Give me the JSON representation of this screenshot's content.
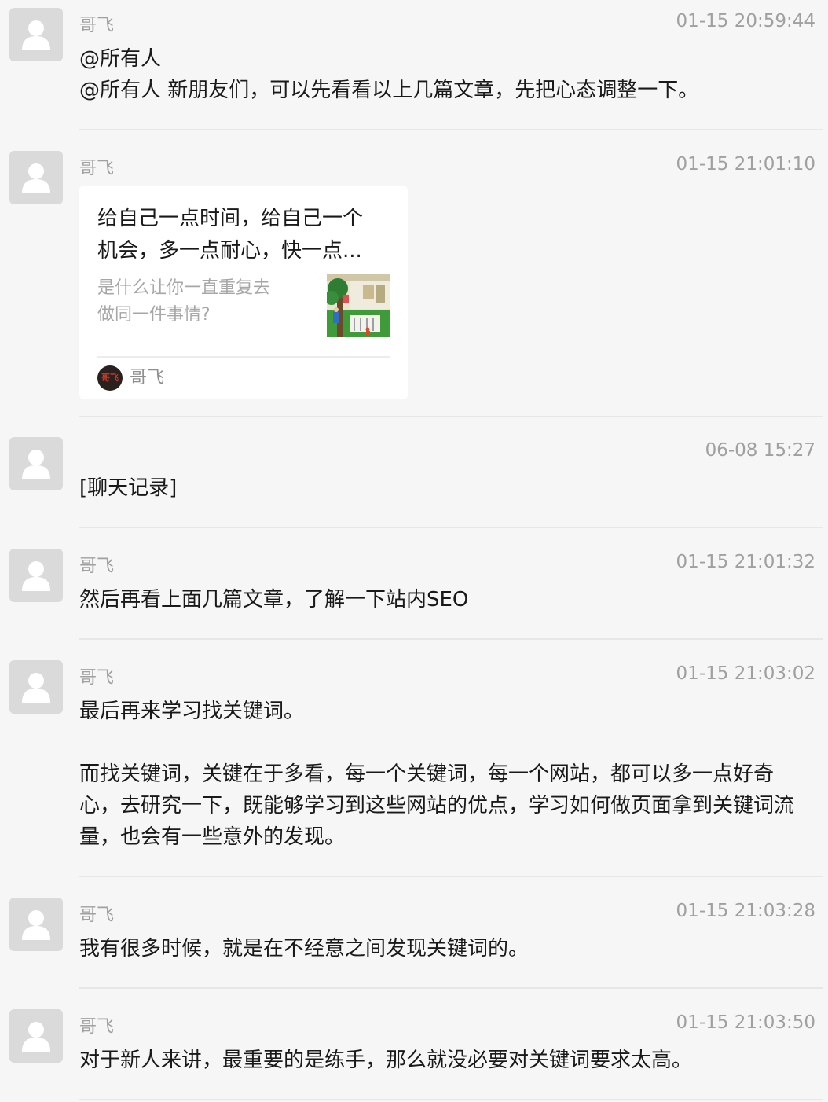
{
  "messages": [
    {
      "sender": "哥飞",
      "time": "01-15 20:59:44",
      "text": "@所有人\n@所有人 新朋友们，可以先看看以上几篇文章，先把心态调整一下。"
    },
    {
      "sender": "哥飞",
      "time": "01-15 21:01:10",
      "card": {
        "title": "给自己一点时间，给自己一个\n机会，多一点耐心，快一点...",
        "description": "是什么让你一直重复去\n做同一件事情?",
        "source_name": "哥飞",
        "source_avatar_text": "哥飞"
      }
    },
    {
      "sender": "",
      "time": "06-08 15:27",
      "text": "[聊天记录]"
    },
    {
      "sender": "哥飞",
      "time": "01-15 21:01:32",
      "text": "然后再看上面几篇文章，了解一下站内SEO"
    },
    {
      "sender": "哥飞",
      "time": "01-15 21:03:02",
      "text": "最后再来学习找关键词。\n\n而找关键词，关键在于多看，每一个关键词，每一个网站，都可以多一点好奇心，去研究一下，既能够学习到这些网站的优点，学习如何做页面拿到关键词流量，也会有一些意外的发现。"
    },
    {
      "sender": "哥飞",
      "time": "01-15 21:03:28",
      "text": "我有很多时候，就是在不经意之间发现关键词的。"
    },
    {
      "sender": "哥飞",
      "time": "01-15 21:03:50",
      "text": "对于新人来讲，最重要的是练手，那么就没必要对关键词要求太高。"
    }
  ],
  "icons": {
    "avatar": "default-user-avatar-icon"
  },
  "colors": {
    "background": "#f6f6f6",
    "avatar_bg": "#dadada",
    "meta_text": "#a0a0a0",
    "body_text": "#191919",
    "card_bg": "#ffffff"
  }
}
